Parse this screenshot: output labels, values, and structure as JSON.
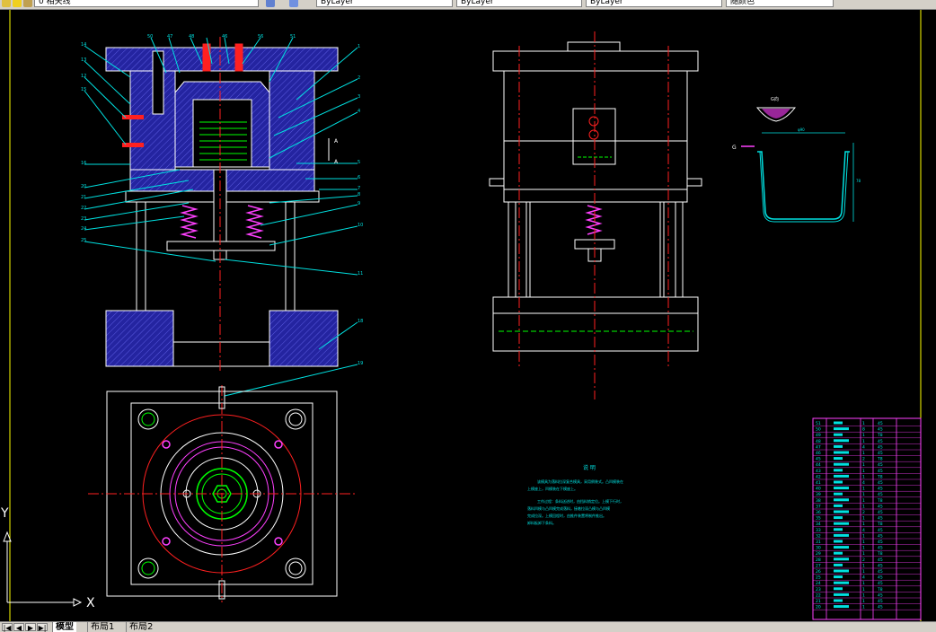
{
  "toolbar": {
    "layer_field": "0 相关线",
    "linetype_1": "ByLayer",
    "linetype_2": "ByLayer",
    "linetype_3": "ByLayer",
    "color_field": "随颜色"
  },
  "drawing": {
    "part_leaders_top": [
      "50",
      "47",
      "48",
      "46",
      "56",
      "51"
    ],
    "part_leaders_left": [
      "14",
      "13",
      "12",
      "15",
      "16",
      "20",
      "21",
      "22",
      "23",
      "24",
      "25"
    ],
    "part_leaders_right": [
      "1",
      "2",
      "3",
      "4",
      "5",
      "6",
      "7",
      "8",
      "9",
      "10",
      "11",
      "18",
      "19"
    ],
    "section_label_upper": "A",
    "section_label_lower": "A",
    "view_label": "G",
    "detail_label": "G向",
    "dim_width": "φ90",
    "dim_height": "78"
  },
  "notes": {
    "title": "说 明",
    "lines": [
      "该模具为落料拉深复合模具，采用倒装式。凸凹模装在",
      "上模座上，凹模装在下模座上。",
      "工作过程：条料送进时，由挡料销定位。上模下行时，",
      "落料凹模与凸凹模完成落料，接着拉深凸模与凸凹模",
      "完成拉深。上模回程时，由推件装置将制件推出。",
      "卸料板卸下条料。"
    ]
  },
  "title_block": {
    "rows": [
      {
        "no": "51",
        "qty": "1",
        "mat": "45"
      },
      {
        "no": "50",
        "qty": "8",
        "mat": "45"
      },
      {
        "no": "49",
        "qty": "1",
        "mat": "T8"
      },
      {
        "no": "48",
        "qty": "1",
        "mat": "45"
      },
      {
        "no": "47",
        "qty": "4",
        "mat": "45"
      },
      {
        "no": "46",
        "qty": "1",
        "mat": "45"
      },
      {
        "no": "45",
        "qty": "2",
        "mat": "T8"
      },
      {
        "no": "44",
        "qty": "1",
        "mat": "45"
      },
      {
        "no": "43",
        "qty": "1",
        "mat": "45"
      },
      {
        "no": "42",
        "qty": "1",
        "mat": "T8"
      },
      {
        "no": "41",
        "qty": "4",
        "mat": "45"
      },
      {
        "no": "40",
        "qty": "1",
        "mat": "45"
      },
      {
        "no": "39",
        "qty": "1",
        "mat": "45"
      },
      {
        "no": "38",
        "qty": "1",
        "mat": "T8"
      },
      {
        "no": "37",
        "qty": "1",
        "mat": "45"
      },
      {
        "no": "36",
        "qty": "2",
        "mat": "45"
      },
      {
        "no": "35",
        "qty": "1",
        "mat": "45"
      },
      {
        "no": "34",
        "qty": "1",
        "mat": "T8"
      },
      {
        "no": "33",
        "qty": "4",
        "mat": "45"
      },
      {
        "no": "32",
        "qty": "1",
        "mat": "45"
      },
      {
        "no": "31",
        "qty": "1",
        "mat": "45"
      },
      {
        "no": "30",
        "qty": "1",
        "mat": "45"
      },
      {
        "no": "29",
        "qty": "1",
        "mat": "T8"
      },
      {
        "no": "28",
        "qty": "2",
        "mat": "45"
      },
      {
        "no": "27",
        "qty": "1",
        "mat": "45"
      },
      {
        "no": "26",
        "qty": "1",
        "mat": "45"
      },
      {
        "no": "25",
        "qty": "4",
        "mat": "45"
      },
      {
        "no": "24",
        "qty": "1",
        "mat": "45"
      },
      {
        "no": "23",
        "qty": "1",
        "mat": "T8"
      },
      {
        "no": "22",
        "qty": "1",
        "mat": "45"
      },
      {
        "no": "21",
        "qty": "1",
        "mat": "45"
      },
      {
        "no": "20",
        "qty": "1",
        "mat": "45"
      }
    ]
  },
  "axes": {
    "x_label": "X",
    "y_label": "Y"
  },
  "tabs": {
    "nav": [
      "|◀",
      "◀",
      "▶",
      "▶|"
    ],
    "model": "模型",
    "layout1": "布局1",
    "layout2": "布局2"
  },
  "colors": {
    "background": "#000000",
    "hatch": "#2a2aa8",
    "line": "#ffffff",
    "center": "#ff2020",
    "leader": "#00e0e0",
    "spring": "#ff40ff",
    "green": "#00ff00",
    "yellow": "#ffff00",
    "border": "#ffff00"
  }
}
